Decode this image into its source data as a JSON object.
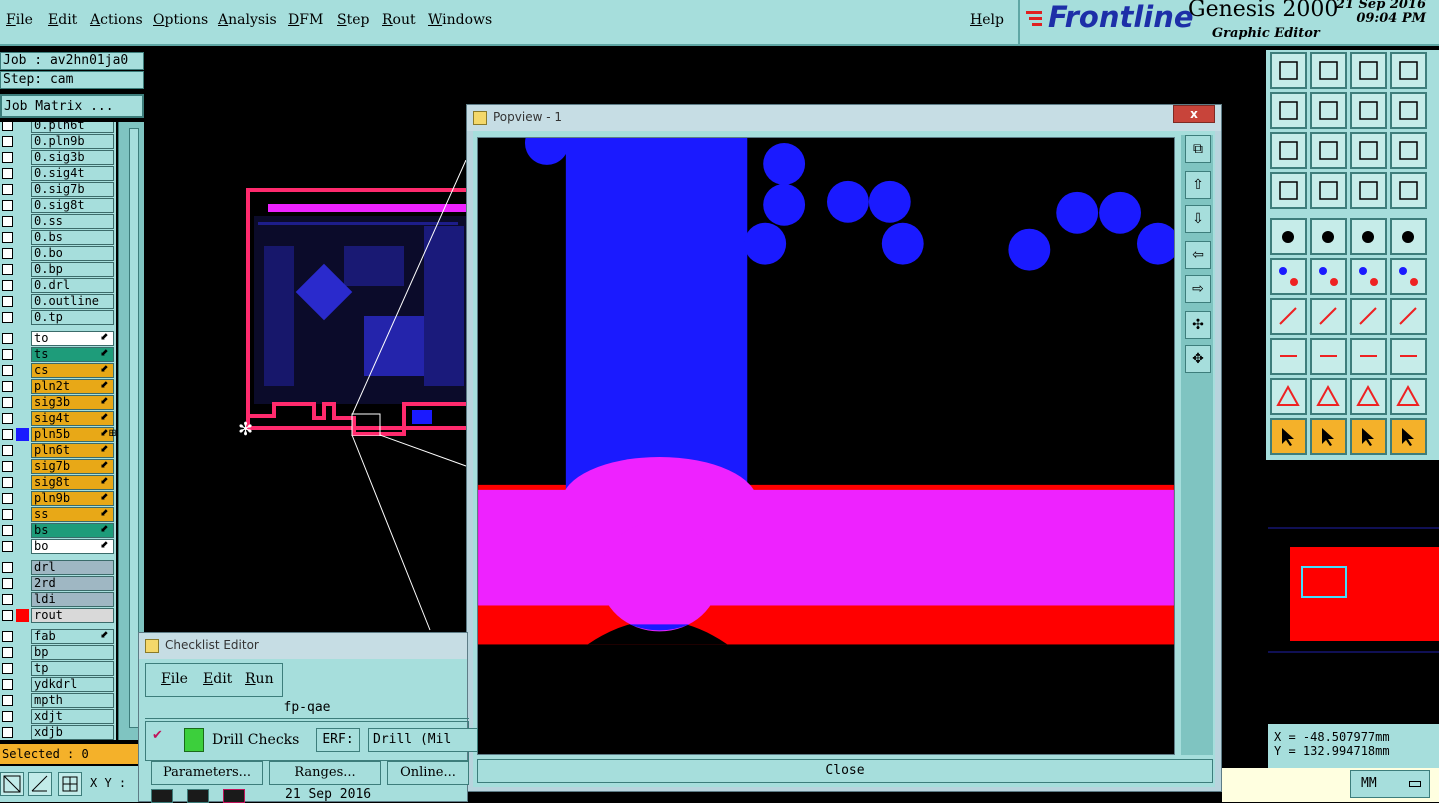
{
  "menu": {
    "items": [
      "File",
      "Edit",
      "Actions",
      "Options",
      "Analysis",
      "DFM",
      "Step",
      "Rout",
      "Windows"
    ],
    "help": "Help"
  },
  "brand": {
    "logo": "Frontline",
    "product": "Genesis 2000",
    "subtitle": "Graphic Editor",
    "date": "21 Sep 2016",
    "time": "09:04 PM"
  },
  "job": {
    "job_label": "Job : av2hn01ja0",
    "step_label": "Step: cam",
    "matrix_button": "Job Matrix ..."
  },
  "layers": [
    {
      "name": "0.pln6t",
      "color": "#a6dedc",
      "mk": ""
    },
    {
      "name": "0.pln9b",
      "color": "#a6dedc",
      "mk": ""
    },
    {
      "name": "0.sig3b",
      "color": "#a6dedc",
      "mk": ""
    },
    {
      "name": "0.sig4t",
      "color": "#a6dedc",
      "mk": ""
    },
    {
      "name": "0.sig7b",
      "color": "#a6dedc",
      "mk": ""
    },
    {
      "name": "0.sig8t",
      "color": "#a6dedc",
      "mk": ""
    },
    {
      "name": "0.ss",
      "color": "#a6dedc",
      "mk": ""
    },
    {
      "name": "0.bs",
      "color": "#a6dedc",
      "mk": ""
    },
    {
      "name": "0.bo",
      "color": "#a6dedc",
      "mk": ""
    },
    {
      "name": "0.bp",
      "color": "#a6dedc",
      "mk": ""
    },
    {
      "name": "0.drl",
      "color": "#a6dedc",
      "mk": ""
    },
    {
      "name": "0.outline",
      "color": "#a6dedc",
      "mk": ""
    },
    {
      "name": "0.tp",
      "color": "#a6dedc",
      "mk": ""
    },
    {
      "name": "to",
      "color": "#ffffff",
      "mk": "⬋"
    },
    {
      "name": "ts",
      "color": "#1e9c7a",
      "mk": "⬋"
    },
    {
      "name": "cs",
      "color": "#e8a817",
      "mk": "⬋"
    },
    {
      "name": "pln2t",
      "color": "#e8a817",
      "mk": "⬋"
    },
    {
      "name": "sig3b",
      "color": "#e8a817",
      "mk": "⬋"
    },
    {
      "name": "sig4t",
      "color": "#e8a817",
      "mk": "⬋"
    },
    {
      "name": "pln5b",
      "color": "#e8a817",
      "mk": "⬋⊞"
    },
    {
      "name": "pln6t",
      "color": "#e8a817",
      "mk": "⬋"
    },
    {
      "name": "sig7b",
      "color": "#e8a817",
      "mk": "⬋"
    },
    {
      "name": "sig8t",
      "color": "#e8a817",
      "mk": "⬋"
    },
    {
      "name": "pln9b",
      "color": "#e8a817",
      "mk": "⬋"
    },
    {
      "name": "ss",
      "color": "#e8a817",
      "mk": "⬋"
    },
    {
      "name": "bs",
      "color": "#1e9c7a",
      "mk": "⬋"
    },
    {
      "name": "bo",
      "color": "#ffffff",
      "mk": "⬋"
    },
    {
      "name": "drl",
      "color": "#9fb7c3",
      "mk": ""
    },
    {
      "name": "2rd",
      "color": "#9fb7c3",
      "mk": ""
    },
    {
      "name": "ldi",
      "color": "#9fb7c3",
      "mk": ""
    },
    {
      "name": "rout",
      "color": "#d9d9d9",
      "mk": ""
    },
    {
      "name": "fab",
      "color": "#a6dedc",
      "mk": "⬋"
    },
    {
      "name": "bp",
      "color": "#a6dedc",
      "mk": ""
    },
    {
      "name": "tp",
      "color": "#a6dedc",
      "mk": ""
    },
    {
      "name": "ydkdrl",
      "color": "#a6dedc",
      "mk": ""
    },
    {
      "name": "mpth",
      "color": "#a6dedc",
      "mk": ""
    },
    {
      "name": "xdjt",
      "color": "#a6dedc",
      "mk": ""
    },
    {
      "name": "xdjb",
      "color": "#a6dedc",
      "mk": ""
    }
  ],
  "selected_label": "Selected : 0",
  "xy_label": "X Y :",
  "popview": {
    "title": "Popview - 1",
    "close_x": "x",
    "close_button": "Close"
  },
  "checklist": {
    "title": "Checklist Editor",
    "menu": [
      "File",
      "Edit",
      "Run"
    ],
    "name": "fp-qae",
    "check_name": "Drill Checks",
    "erf_label": "ERF:",
    "erf_value": "Drill (Mil",
    "buttons": [
      "Parameters...",
      "Ranges...",
      "Online..."
    ],
    "date": "21 Sep 2016"
  },
  "coords": {
    "x": "X = -48.507977mm",
    "y": "Y = 132.994718mm"
  },
  "units": "MM",
  "colors": {
    "panel": "#a6dedc",
    "blue_feature": "#1a1aff",
    "magenta_feature": "#ee22ff",
    "red_feature": "#ff0000"
  }
}
